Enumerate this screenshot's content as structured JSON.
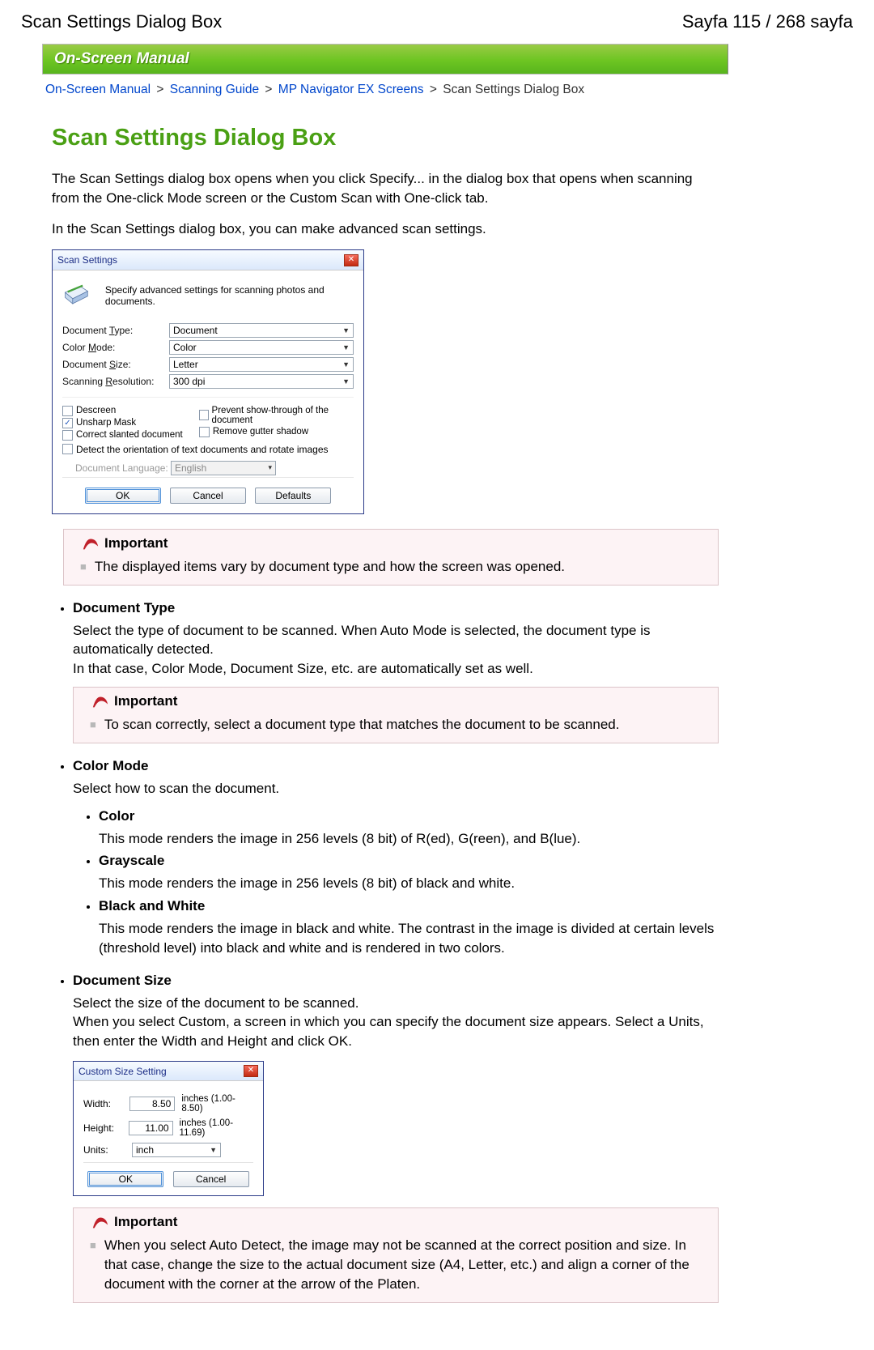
{
  "header": {
    "left": "Scan Settings Dialog Box",
    "right": "Sayfa 115 / 268 sayfa"
  },
  "banner": {
    "title": "On-Screen Manual"
  },
  "breadcrumb": {
    "items": [
      "On-Screen Manual",
      "Scanning Guide",
      "MP Navigator EX Screens"
    ],
    "current": "Scan Settings Dialog Box",
    "sep": ">"
  },
  "page_title": "Scan Settings Dialog Box",
  "intro": {
    "p1": "The Scan Settings dialog box opens when you click Specify... in the dialog box that opens when scanning from the One-click Mode screen or the Custom Scan with One-click tab.",
    "p2": "In the Scan Settings dialog box, you can make advanced scan settings."
  },
  "scan_dialog": {
    "title": "Scan Settings",
    "subtitle": "Specify advanced settings for scanning photos and documents.",
    "labels": {
      "doc_type_pre": "Document ",
      "doc_type_u": "T",
      "doc_type_post": "ype:",
      "color_mode_pre": "Color ",
      "color_mode_u": "M",
      "color_mode_post": "ode:",
      "doc_size_pre": "Document ",
      "doc_size_u": "S",
      "doc_size_post": "ize:",
      "scan_res_pre": "Scanning ",
      "scan_res_u": "R",
      "scan_res_post": "esolution:",
      "doc_lang_pre": "Document ",
      "doc_lang_u": "L",
      "doc_lang_post": "anguage:"
    },
    "values": {
      "doc_type": "Document",
      "color_mode": "Color",
      "doc_size": "Letter",
      "scan_res": "300 dpi",
      "doc_lang": "English"
    },
    "checks": {
      "descreen_u": "D",
      "descreen": "escreen",
      "unsharp_u": "U",
      "unsharp": "nsharp Mask",
      "slanted_u": "C",
      "slanted": "orrect slanted document",
      "detect": "Detect the orientation of text documents and rotate images",
      "prevent_pre": "Pre",
      "prevent_u": "v",
      "prevent_post": "ent show-through of the document",
      "gutter_pre": "Remove ",
      "gutter_u": "g",
      "gutter_post": "utter shadow"
    },
    "buttons": {
      "ok": "OK",
      "cancel": "Cancel",
      "defaults_u": "D",
      "defaults": "efaults"
    }
  },
  "notes": {
    "heading": "Important",
    "n1": "The displayed items vary by document type and how the screen was opened.",
    "n2": "To scan correctly, select a document type that matches the document to be scanned.",
    "n3": "When you select Auto Detect, the image may not be scanned at the correct position and size. In that case, change the size to the actual document size (A4, Letter, etc.) and align a corner of the document with the corner at the arrow of the Platen."
  },
  "doctype": {
    "title": "Document Type",
    "body1": "Select the type of document to be scanned. When Auto Mode is selected, the document type is automatically detected.",
    "body2": "In that case, Color Mode, Document Size, etc. are automatically set as well."
  },
  "colormode": {
    "title": "Color Mode",
    "body": "Select how to scan the document.",
    "color_title": "Color",
    "color_body": "This mode renders the image in 256 levels (8 bit) of R(ed), G(reen), and B(lue).",
    "gray_title": "Grayscale",
    "gray_body": "This mode renders the image in 256 levels (8 bit) of black and white.",
    "bw_title": "Black and White",
    "bw_body": "This mode renders the image in black and white. The contrast in the image is divided at certain levels (threshold level) into black and white and is rendered in two colors."
  },
  "docsize": {
    "title": "Document Size",
    "body1": "Select the size of the document to be scanned.",
    "body2": "When you select Custom, a screen in which you can specify the document size appears. Select a Units, then enter the Width and Height and click OK."
  },
  "custom_dialog": {
    "title": "Custom Size Setting",
    "width_u": "W",
    "width_lab": "idth:",
    "width_val": "8.50",
    "width_range": "inches (1.00-8.50)",
    "height_u": "H",
    "height_lab": "eight:",
    "height_val": "11.00",
    "height_range": "inches (1.00-11.69)",
    "units_u": "U",
    "units_lab": "nits:",
    "units_val": "inch",
    "ok": "OK",
    "cancel": "Cancel"
  }
}
